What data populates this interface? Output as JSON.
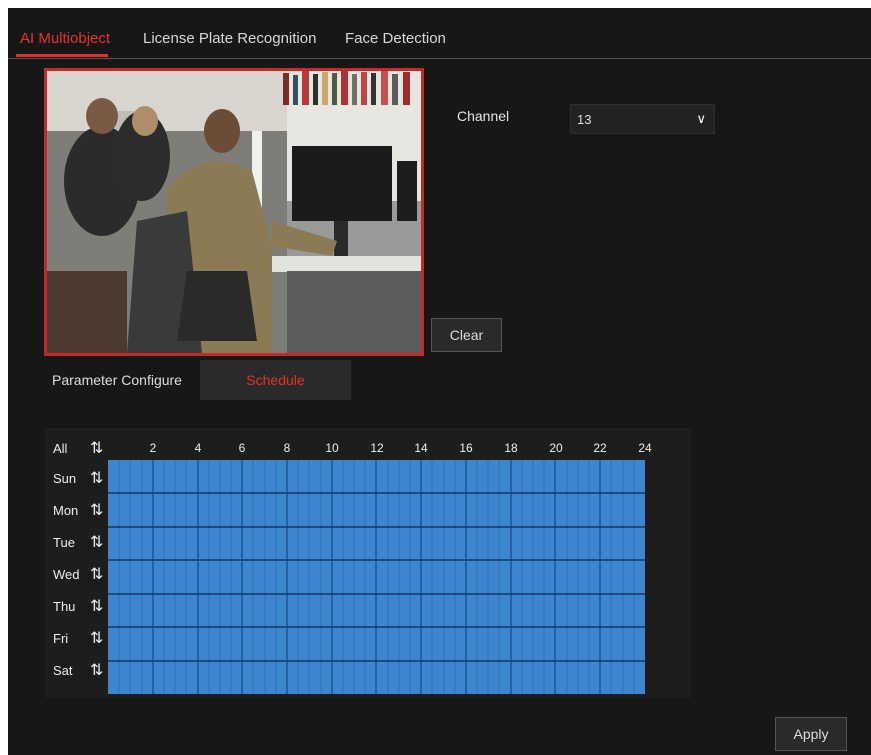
{
  "tabs": [
    {
      "label": "AI Multiobject",
      "active": true
    },
    {
      "label": "License Plate Recognition",
      "active": false
    },
    {
      "label": "Face Detection",
      "active": false
    }
  ],
  "channel": {
    "label": "Channel",
    "value": "13"
  },
  "clear_label": "Clear",
  "subtabs": [
    {
      "label": "Parameter Configure",
      "active": false
    },
    {
      "label": "Schedule",
      "active": true
    }
  ],
  "schedule": {
    "all_label": "All",
    "days": [
      "Sun",
      "Mon",
      "Tue",
      "Wed",
      "Thu",
      "Fri",
      "Sat"
    ],
    "hours": [
      "2",
      "4",
      "6",
      "8",
      "10",
      "12",
      "14",
      "16",
      "18",
      "20",
      "22",
      "24"
    ],
    "selection": "all days, 0-24"
  },
  "apply_label": "Apply",
  "colors": {
    "accent": "#e2332b",
    "schedule_fill": "#3c86d0",
    "background": "#171717"
  },
  "icons": {
    "sync": "refresh-icon",
    "dropdown": "chevron-down-icon"
  }
}
